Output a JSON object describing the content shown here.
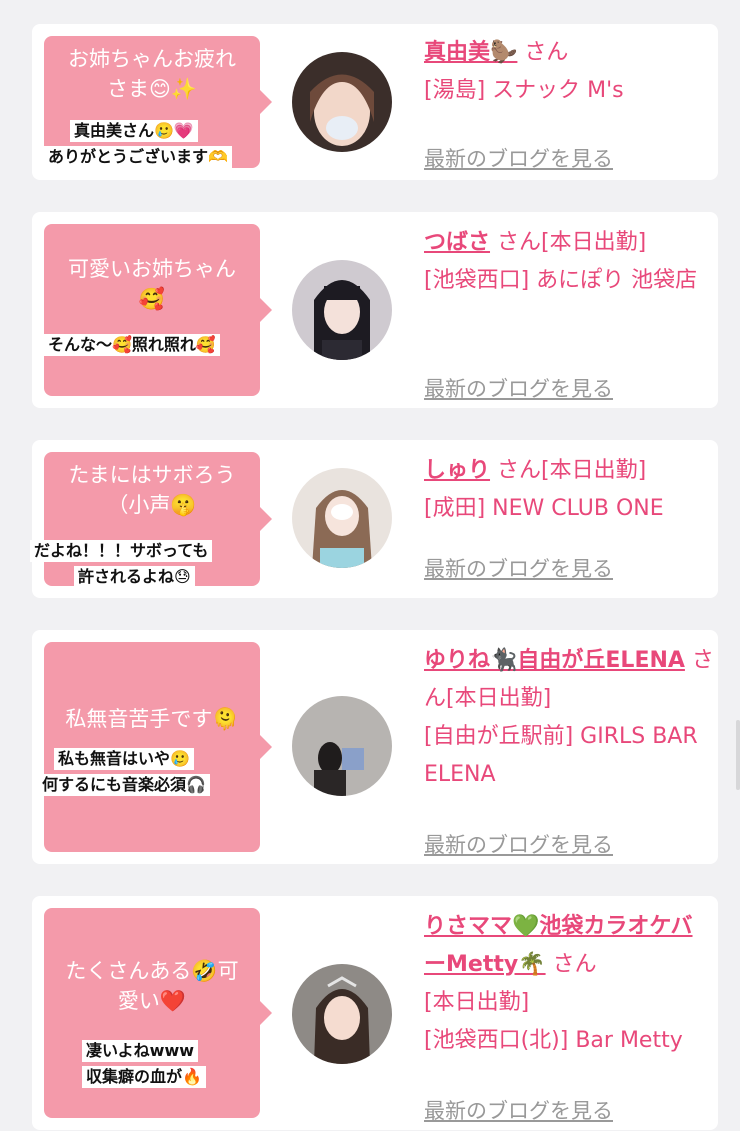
{
  "cards": [
    {
      "question": "お姉ちゃんお疲れさま😊✨",
      "reply_line1": "真由美さん🥲💗",
      "reply_line2": "ありがとうございます🫶",
      "name": "真由美🦫",
      "suffix": " さん",
      "shop": "[湯島] スナック M's",
      "blog": "最新のブログを見る"
    },
    {
      "question": "可愛いお姉ちゃん🥰",
      "reply_line1": "そんな〜🥰照れ照れ🥰",
      "reply_line2": "",
      "name": "つばさ",
      "suffix": " さん[本日出勤]",
      "shop": "[池袋西口] あにぽり 池袋店",
      "blog": "最新のブログを見る"
    },
    {
      "question": "たまにはサボろう（小声🤫",
      "reply_line1": "だよね！！！サボっても",
      "reply_line2": "許されるよね😓",
      "name": "しゅり",
      "suffix": " さん[本日出勤]",
      "shop": "[成田] NEW CLUB ONE",
      "blog": "最新のブログを見る"
    },
    {
      "question": "私無音苦手です🫠",
      "reply_line1": "私も無音はいや🥲",
      "reply_line2": "何するにも音楽必須🎧",
      "name": "ゆりね🐈‍⬛自由が丘ELENA",
      "suffix": " さん[本日出勤]",
      "shop": "[自由が丘駅前] GIRLS BAR ELENA",
      "blog": "最新のブログを見る"
    },
    {
      "question": "たくさんある🤣可愛い❤️",
      "reply_line1": "凄いよねwww",
      "reply_line2": "収集癖の血が🔥",
      "name": "りさママ💚池袋カラオケバーMetty🌴",
      "suffix": " さん",
      "status": "[本日出勤]",
      "shop": "[池袋西口(北)] Bar Metty",
      "blog": "最新のブログを見る"
    }
  ],
  "colors": {
    "bubble": "#f49aaa",
    "accent": "#e8487a",
    "link_gray": "#999999",
    "background": "#f1f1f3"
  }
}
